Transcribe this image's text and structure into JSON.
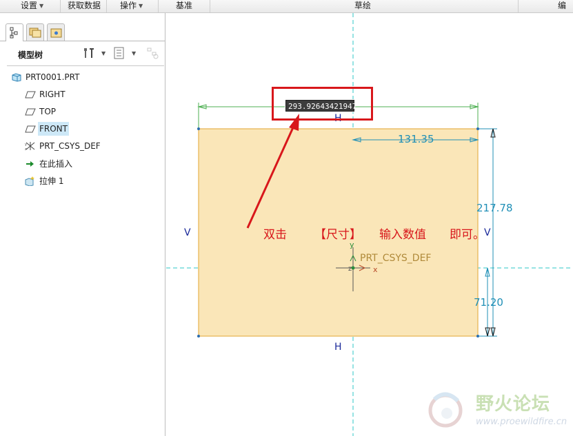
{
  "menu": {
    "settings": "设置",
    "get_data": "获取数据",
    "operations": "操作",
    "datum": "基准",
    "sketch": "草绘",
    "edit_partial": "编"
  },
  "model_tree": {
    "title": "模型树",
    "items": [
      {
        "label": "PRT0001.PRT",
        "icon": "part-icon"
      },
      {
        "label": "RIGHT",
        "icon": "datum-plane-icon"
      },
      {
        "label": "TOP",
        "icon": "datum-plane-icon"
      },
      {
        "label": "FRONT",
        "icon": "datum-plane-icon",
        "selected": true
      },
      {
        "label": "PRT_CSYS_DEF",
        "icon": "csys-icon"
      },
      {
        "label": "在此插入",
        "icon": "insert-here-arrow-icon"
      },
      {
        "label": "拉伸 1",
        "icon": "extrude-feature-icon"
      }
    ]
  },
  "sketch": {
    "dim_input_value": "293.92643421947",
    "dim_horizontal": "131.35",
    "dim_vertical_total": "217.78",
    "dim_vertical_lower": "71.20",
    "constraint_h": "H",
    "constraint_v": "V",
    "csys_label": "PRT_CSYS_DEF",
    "csys_axis_x": "x",
    "csys_axis_y": "y",
    "csys_axis_z": "z"
  },
  "annotation": {
    "part1": "双击",
    "part2": "【尺寸】",
    "part3": "输入数值",
    "part4": "即可。",
    "color": "#d8171b"
  },
  "watermark": {
    "title": "野火论坛",
    "url": "www.proewildfire.cn"
  },
  "colors": {
    "sketch_fill": "#fae6b8",
    "sketch_edge": "#e6b24e",
    "dimension": "#1f8fb6",
    "centerline": "#2cc7c7",
    "constraint": "#1b2a9a"
  }
}
